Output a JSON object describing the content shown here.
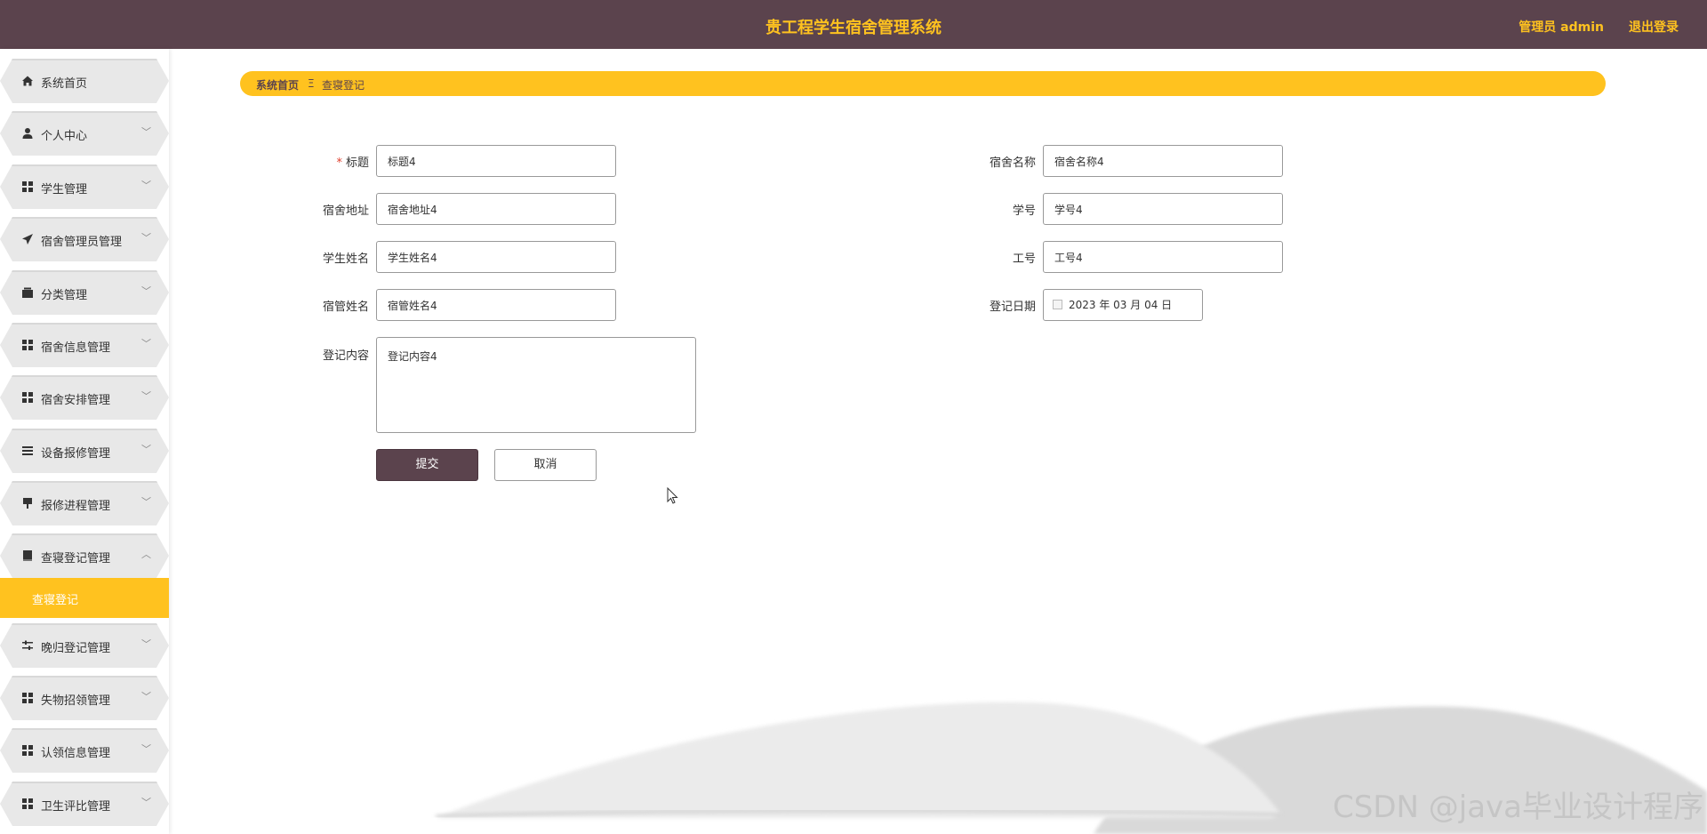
{
  "header": {
    "title": "贵工程学生宿舍管理系统",
    "user": "管理员 admin",
    "logout": "退出登录"
  },
  "sidebar": {
    "items": [
      {
        "label": "系统首页",
        "icon": "home-icon",
        "glyph": "⌂",
        "arrow": ""
      },
      {
        "label": "个人中心",
        "icon": "person-icon",
        "glyph": "●",
        "arrow": "﹀"
      },
      {
        "label": "学生管理",
        "icon": "grid-icon",
        "glyph": "▦",
        "arrow": "﹀"
      },
      {
        "label": "宿舍管理员管理",
        "icon": "send-icon",
        "glyph": "➤",
        "arrow": "﹀"
      },
      {
        "label": "分类管理",
        "icon": "wallet-icon",
        "glyph": "▰",
        "arrow": "﹀"
      },
      {
        "label": "宿舍信息管理",
        "icon": "grid-icon",
        "glyph": "▦",
        "arrow": "﹀"
      },
      {
        "label": "宿舍安排管理",
        "icon": "grid-icon",
        "glyph": "▦",
        "arrow": "﹀"
      },
      {
        "label": "设备报修管理",
        "icon": "list-icon",
        "glyph": "☰",
        "arrow": "﹀"
      },
      {
        "label": "报修进程管理",
        "icon": "flag-icon",
        "glyph": "▼",
        "arrow": "﹀"
      },
      {
        "label": "查寝登记管理",
        "icon": "book-icon",
        "glyph": "▬",
        "arrow": "︿"
      },
      {
        "label": "晚归登记管理",
        "icon": "sliders-icon",
        "glyph": "≡",
        "arrow": "﹀"
      },
      {
        "label": "失物招领管理",
        "icon": "grid-icon",
        "glyph": "▦",
        "arrow": "﹀"
      },
      {
        "label": "认领信息管理",
        "icon": "grid-icon",
        "glyph": "▦",
        "arrow": "﹀"
      },
      {
        "label": "卫生评比管理",
        "icon": "grid-icon",
        "glyph": "▦",
        "arrow": "﹀"
      }
    ],
    "active_sub": "查寝登记"
  },
  "breadcrumb": {
    "home": "系统首页",
    "separator": "Ξ",
    "current": "查寝登记"
  },
  "form": {
    "required_mark": "*",
    "title_label": "标题",
    "title_value": "标题4",
    "dorm_name_label": "宿舍名称",
    "dorm_name_value": "宿舍名称4",
    "dorm_address_label": "宿舍地址",
    "dorm_address_value": "宿舍地址4",
    "student_no_label": "学号",
    "student_no_value": "学号4",
    "student_name_label": "学生姓名",
    "student_name_value": "学生姓名4",
    "staff_no_label": "工号",
    "staff_no_value": "工号4",
    "manager_name_label": "宿管姓名",
    "manager_name_value": "宿管姓名4",
    "date_label": "登记日期",
    "date_value": "2023 年 03 月 04 日",
    "content_label": "登记内容",
    "content_value": "登记内容4",
    "submit": "提交",
    "cancel": "取消"
  },
  "watermark": "CSDN @java毕业设计程序",
  "colors": {
    "header_bg": "#5b434d",
    "accent": "#ffc21f",
    "menu_bg": "#e8e8e8",
    "required": "#e0412f"
  }
}
